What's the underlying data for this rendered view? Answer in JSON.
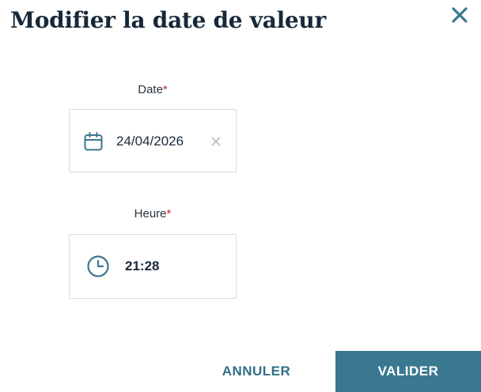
{
  "dialog": {
    "title": "Modifier la date de valeur",
    "close_icon": "close-icon",
    "accent_color": "#3a7890"
  },
  "date_field": {
    "label": "Date",
    "required_mark": "*",
    "value": "24/04/2026",
    "icon": "calendar-icon",
    "clear_icon": "clear-icon"
  },
  "time_field": {
    "label": "Heure",
    "required_mark": "*",
    "value": "21:28",
    "icon": "clock-icon"
  },
  "actions": {
    "cancel_label": "ANNULER",
    "submit_label": "VALIDER"
  }
}
